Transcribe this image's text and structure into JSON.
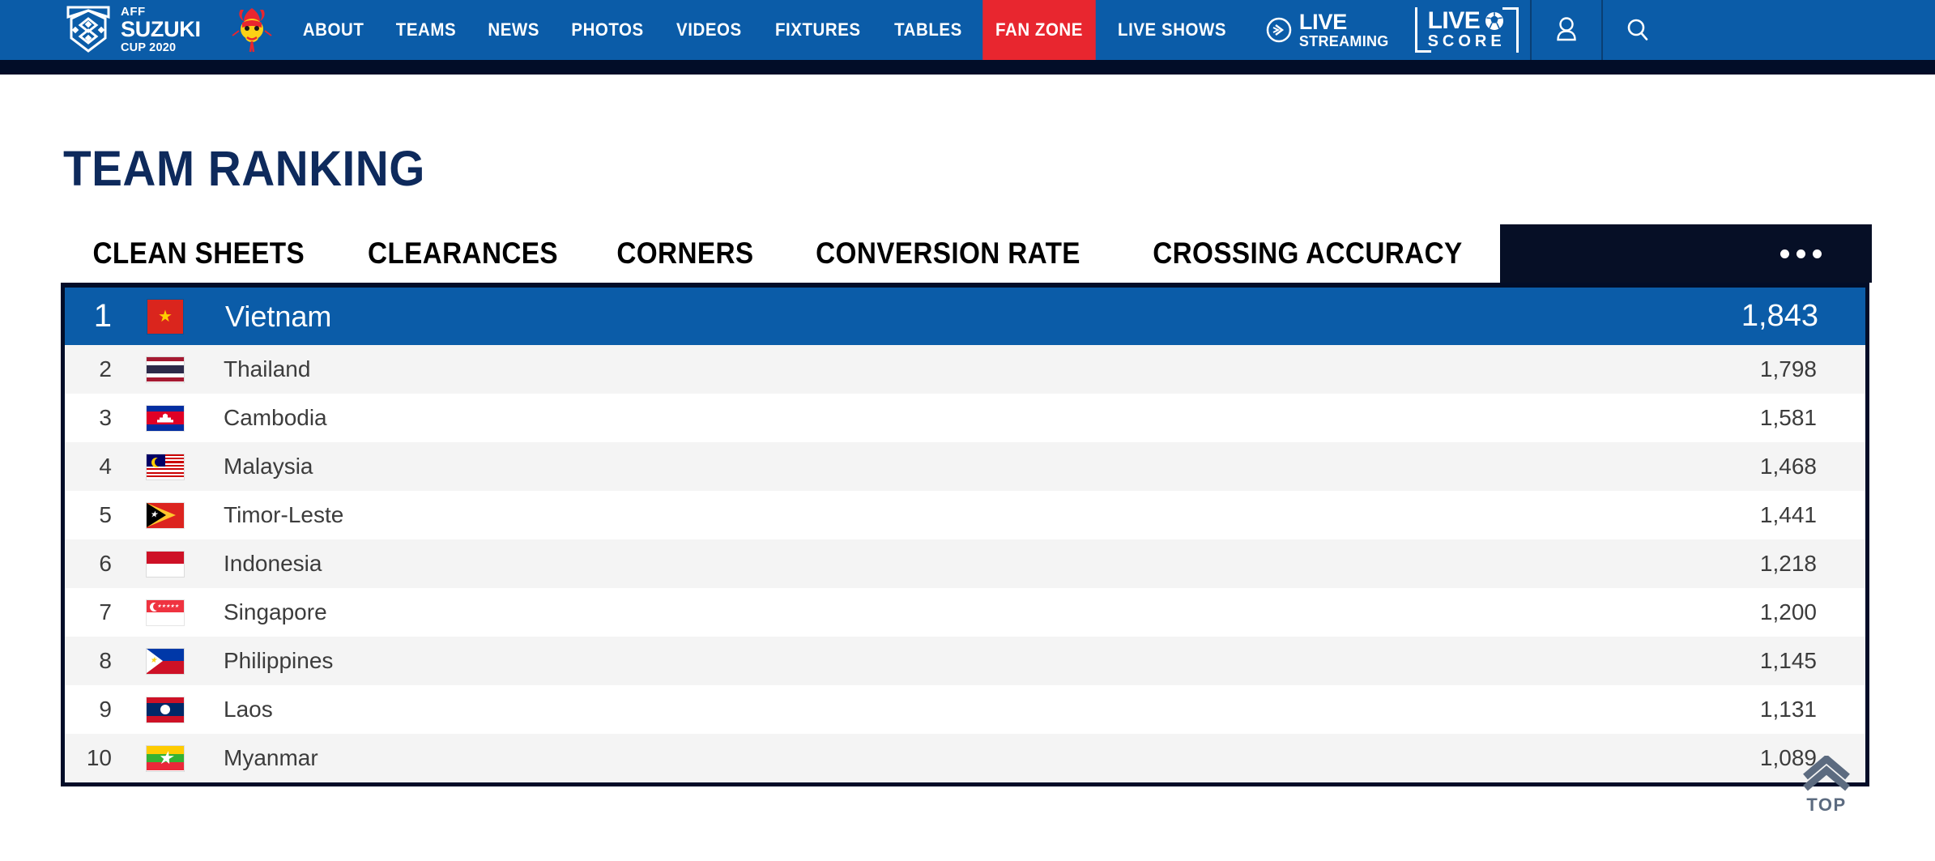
{
  "header": {
    "brand": {
      "aff": "AFF",
      "suzuki": "SUZUKI",
      "cup": "CUP 2020",
      "logo_icon": "aff-suzuki-cup-logo",
      "mascot_icon": "dragon-mascot-icon"
    },
    "nav": [
      {
        "label": "ABOUT",
        "active": false
      },
      {
        "label": "TEAMS",
        "active": false
      },
      {
        "label": "NEWS",
        "active": false
      },
      {
        "label": "PHOTOS",
        "active": false
      },
      {
        "label": "VIDEOS",
        "active": false
      },
      {
        "label": "FIXTURES",
        "active": false
      },
      {
        "label": "TABLES",
        "active": false
      },
      {
        "label": "FAN ZONE",
        "active": true
      },
      {
        "label": "LIVE SHOWS",
        "active": false
      }
    ],
    "live_streaming": {
      "line1": "LIVE",
      "line2": "STREAMING",
      "icon": "play-circle-icon"
    },
    "live_score": {
      "line1": "LIVE",
      "line2": "SCORE",
      "icon": "soccer-ball-icon"
    },
    "tools": [
      {
        "name": "account-icon",
        "glyph": "person"
      },
      {
        "name": "search-icon",
        "glyph": "search"
      }
    ],
    "colors": {
      "header_blue": "#0b5ca8",
      "active_red": "#e8262f",
      "dark_navy": "#020d28"
    }
  },
  "page": {
    "title": "TEAM RANKING"
  },
  "tabs": {
    "items": [
      {
        "label": "CLEAN SHEETS",
        "active": true
      },
      {
        "label": "CLEARANCES",
        "active": false
      },
      {
        "label": "CORNERS",
        "active": false
      },
      {
        "label": "CONVERSION RATE",
        "active": false
      },
      {
        "label": "CROSSING ACCURACY",
        "active": false
      }
    ],
    "more_button": {
      "name": "more-tabs-button",
      "icon": "ellipsis-horizontal-icon"
    }
  },
  "ranking": {
    "rows": [
      {
        "position": "1",
        "team": "Vietnam",
        "value": "1,843",
        "flag": "f-vietnam",
        "leader": true
      },
      {
        "position": "2",
        "team": "Thailand",
        "value": "1,798",
        "flag": "f-thailand",
        "leader": false
      },
      {
        "position": "3",
        "team": "Cambodia",
        "value": "1,581",
        "flag": "f-cambodia",
        "leader": false
      },
      {
        "position": "4",
        "team": "Malaysia",
        "value": "1,468",
        "flag": "f-malaysia",
        "leader": false
      },
      {
        "position": "5",
        "team": "Timor-Leste",
        "value": "1,441",
        "flag": "f-timor",
        "leader": false
      },
      {
        "position": "6",
        "team": "Indonesia",
        "value": "1,218",
        "flag": "f-indonesia",
        "leader": false
      },
      {
        "position": "7",
        "team": "Singapore",
        "value": "1,200",
        "flag": "f-singapore",
        "leader": false
      },
      {
        "position": "8",
        "team": "Philippines",
        "value": "1,145",
        "flag": "f-philippines",
        "leader": false
      },
      {
        "position": "9",
        "team": "Laos",
        "value": "1,131",
        "flag": "f-laos",
        "leader": false
      },
      {
        "position": "10",
        "team": "Myanmar",
        "value": "1,089",
        "flag": "f-myanmar",
        "leader": false
      }
    ]
  },
  "back_to_top": {
    "label": "TOP",
    "icon": "double-chevron-up-icon",
    "color": "#5c6b80"
  }
}
